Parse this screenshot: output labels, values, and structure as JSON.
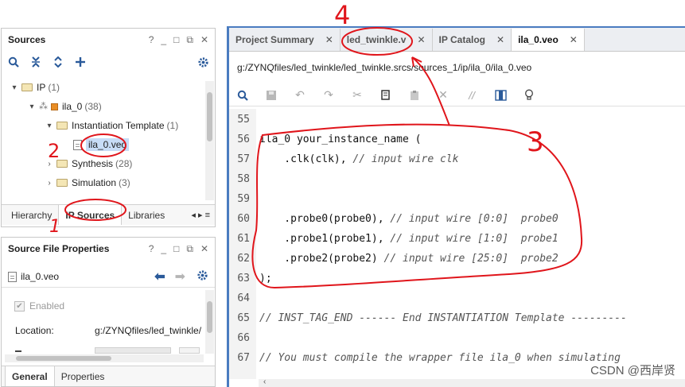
{
  "sources": {
    "title": "Sources",
    "title_actions": [
      "?",
      "_",
      "□",
      "⧉",
      "✕"
    ],
    "tree": [
      {
        "label": "IP",
        "count": "(1)"
      },
      {
        "label": "ila_0",
        "count": "(38)"
      },
      {
        "label": "Instantiation Template",
        "count": "(1)"
      },
      {
        "label": "ila_0.veo"
      },
      {
        "label": "Synthesis",
        "count": "(28)"
      },
      {
        "label": "Simulation",
        "count": "(3)"
      }
    ],
    "tabs": [
      "Hierarchy",
      "IP Sources",
      "Libraries"
    ],
    "tabs_more": "◂ ▸ ≡"
  },
  "properties": {
    "title": "Source File Properties",
    "title_actions": [
      "?",
      "_",
      "□",
      "⧉",
      "✕"
    ],
    "file": "ila_0.veo",
    "enabled_label": "Enabled",
    "location_label": "Location:",
    "location_value": "g:/ZYNQfiles/led_twinkle/",
    "tabs": [
      "General",
      "Properties"
    ]
  },
  "editor": {
    "tabs": [
      {
        "label": "Project Summary"
      },
      {
        "label": "led_twinkle.v"
      },
      {
        "label": "IP Catalog"
      },
      {
        "label": "ila_0.veo"
      }
    ],
    "close_glyph": "✕",
    "path": "g:/ZYNQfiles/led_twinkle/led_twinkle.srcs/sources_1/ip/ila_0/ila_0.veo",
    "lines": [
      {
        "n": "55",
        "code": "",
        "comment": ""
      },
      {
        "n": "56",
        "code": "ila_0 your_instance_name (",
        "comment": ""
      },
      {
        "n": "57",
        "code": "    .clk(clk), ",
        "comment": "// input wire clk"
      },
      {
        "n": "58",
        "code": "",
        "comment": ""
      },
      {
        "n": "59",
        "code": "",
        "comment": ""
      },
      {
        "n": "60",
        "code": "    .probe0(probe0), ",
        "comment": "// input wire [0:0]  probe0"
      },
      {
        "n": "61",
        "code": "    .probe1(probe1), ",
        "comment": "// input wire [1:0]  probe1"
      },
      {
        "n": "62",
        "code": "    .probe2(probe2) ",
        "comment": "// input wire [25:0]  probe2"
      },
      {
        "n": "63",
        "code": ");",
        "comment": ""
      },
      {
        "n": "64",
        "code": "",
        "comment": ""
      },
      {
        "n": "65",
        "code": "",
        "comment": "// INST_TAG_END ------ End INSTANTIATION Template ---------"
      },
      {
        "n": "66",
        "code": "",
        "comment": ""
      },
      {
        "n": "67",
        "code": "",
        "comment": "// You must compile the wrapper file ila_0 when simulating"
      }
    ]
  },
  "annotations": [
    "1",
    "2",
    "3",
    "4"
  ],
  "watermark": "CSDN @西岸贤",
  "colors": {
    "annotation": "#e0151b",
    "accent": "#2a5a9a",
    "selection": "#c7dcf6",
    "ip_icon": "#e98d24"
  }
}
